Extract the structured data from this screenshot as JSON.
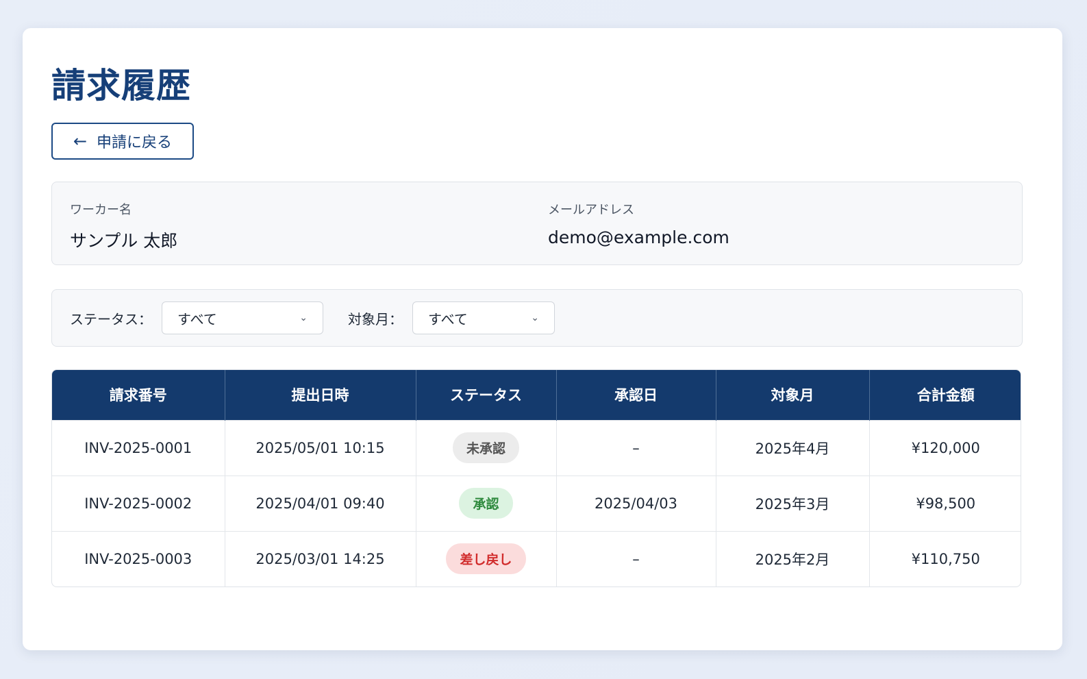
{
  "page": {
    "title": "請求履歴"
  },
  "back_button": {
    "label": "申請に戻る",
    "icon": "arrow-left-icon"
  },
  "worker_info": {
    "name_label": "ワーカー名",
    "name_value": "サンプル 太郎",
    "email_label": "メールアドレス",
    "email_value": "demo@example.com"
  },
  "filters": {
    "status_label": "ステータス：",
    "status_value": "すべて",
    "month_label": "対象月：",
    "month_value": "すべて"
  },
  "table": {
    "headers": [
      "請求番号",
      "提出日時",
      "ステータス",
      "承認日",
      "対象月",
      "合計金額"
    ],
    "rows": [
      {
        "invoice_no": "INV-2025-0001",
        "submitted": "2025/05/01 10:15",
        "status": "未承認",
        "status_type": "pending",
        "approved_date": "–",
        "target_month": "2025年4月",
        "total": "¥120,000"
      },
      {
        "invoice_no": "INV-2025-0002",
        "submitted": "2025/04/01 09:40",
        "status": "承認",
        "status_type": "approved",
        "approved_date": "2025/04/03",
        "target_month": "2025年3月",
        "total": "¥98,500"
      },
      {
        "invoice_no": "INV-2025-0003",
        "submitted": "2025/03/01 14:25",
        "status": "差し戻し",
        "status_type": "returned",
        "approved_date": "–",
        "target_month": "2025年2月",
        "total": "¥110,750"
      }
    ]
  },
  "colors": {
    "header_bg": "#143a6d",
    "title": "#163f78",
    "approved": "#2f8a3e",
    "returned": "#d12b2b"
  }
}
